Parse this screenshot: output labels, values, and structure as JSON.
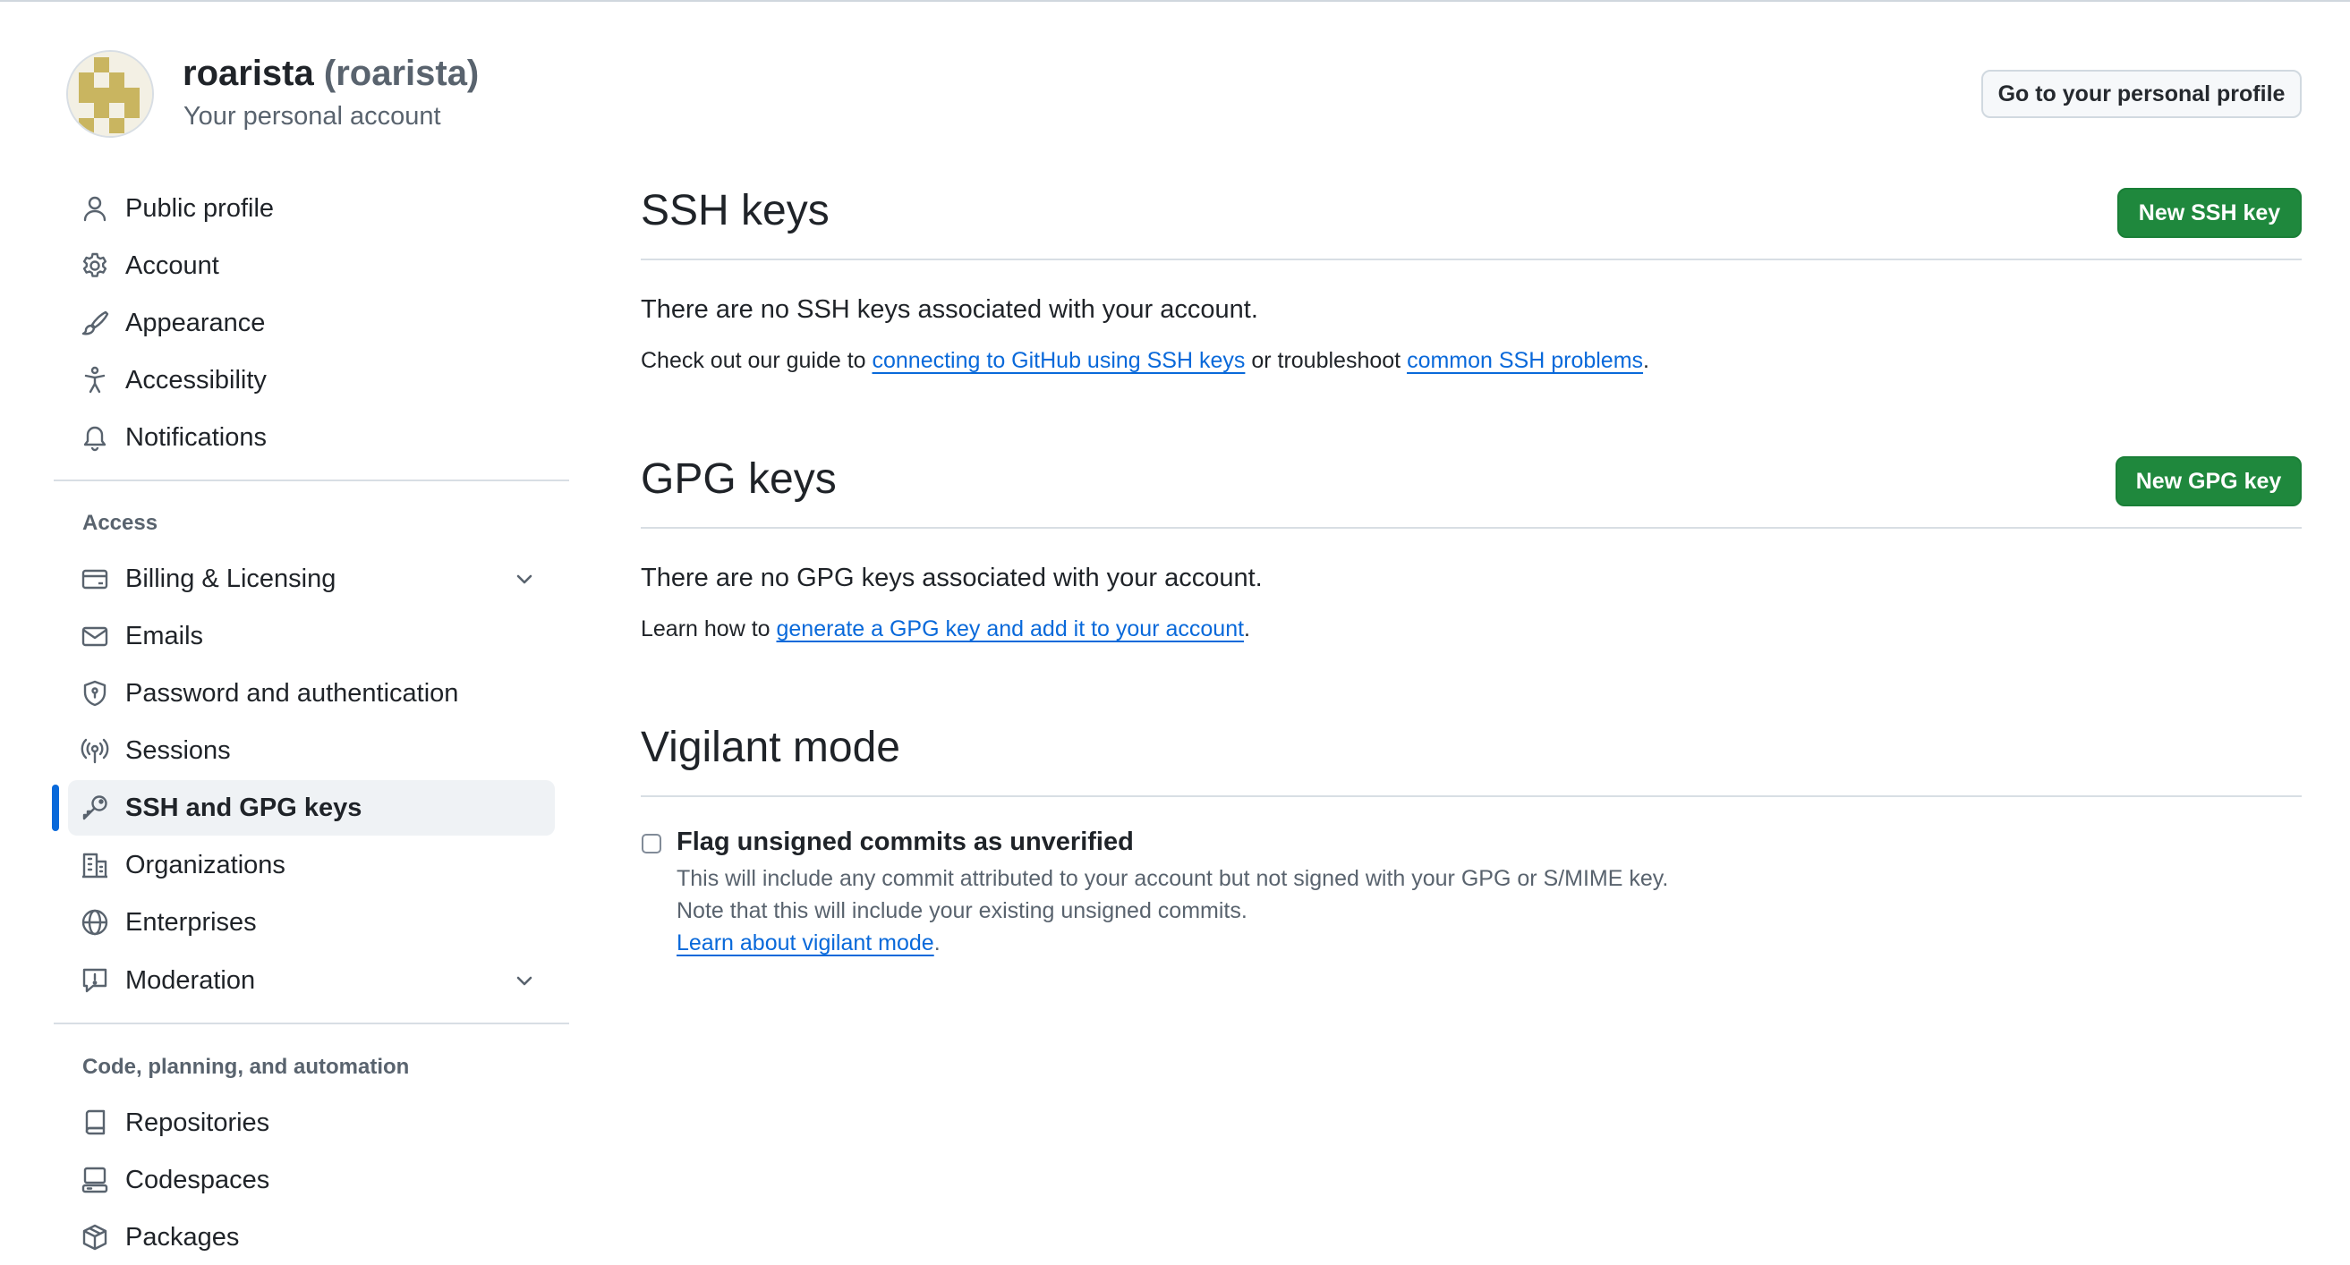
{
  "header": {
    "display_name": "roarista",
    "login": "(roarista)",
    "subtitle": "Your personal account",
    "profile_button": "Go to your personal profile"
  },
  "sidebar": {
    "top_items": [
      {
        "label": "Public profile",
        "icon": "person-icon"
      },
      {
        "label": "Account",
        "icon": "gear-icon"
      },
      {
        "label": "Appearance",
        "icon": "paintbrush-icon"
      },
      {
        "label": "Accessibility",
        "icon": "accessibility-icon"
      },
      {
        "label": "Notifications",
        "icon": "bell-icon"
      }
    ],
    "access_heading": "Access",
    "access_items": [
      {
        "label": "Billing & Licensing",
        "icon": "credit-card-icon",
        "expandable": true
      },
      {
        "label": "Emails",
        "icon": "mail-icon"
      },
      {
        "label": "Password and authentication",
        "icon": "shield-lock-icon"
      },
      {
        "label": "Sessions",
        "icon": "broadcast-icon"
      },
      {
        "label": "SSH and GPG keys",
        "icon": "key-icon",
        "active": true
      },
      {
        "label": "Organizations",
        "icon": "organization-icon"
      },
      {
        "label": "Enterprises",
        "icon": "globe-icon"
      },
      {
        "label": "Moderation",
        "icon": "report-icon",
        "expandable": true
      }
    ],
    "code_heading": "Code, planning, and automation",
    "code_items": [
      {
        "label": "Repositories",
        "icon": "repo-icon"
      },
      {
        "label": "Codespaces",
        "icon": "codespaces-icon"
      },
      {
        "label": "Packages",
        "icon": "package-icon"
      }
    ]
  },
  "ssh": {
    "title": "SSH keys",
    "new_button": "New SSH key",
    "empty_message": "There are no SSH keys associated with your account.",
    "guide_prefix": "Check out our guide to ",
    "guide_link": "connecting to GitHub using SSH keys",
    "guide_middle": " or troubleshoot ",
    "trouble_link": "common SSH problems",
    "guide_suffix": "."
  },
  "gpg": {
    "title": "GPG keys",
    "new_button": "New GPG key",
    "empty_message": "There are no GPG keys associated with your account.",
    "learn_prefix": "Learn how to ",
    "learn_link": "generate a GPG key and add it to your account",
    "learn_suffix": "."
  },
  "vigilant": {
    "title": "Vigilant mode",
    "checkbox_label": "Flag unsigned commits as unverified",
    "checked": false,
    "note_line1": "This will include any commit attributed to your account but not signed with your GPG or S/MIME key.",
    "note_line2": "Note that this will include your existing unsigned commits.",
    "learn_link": "Learn about vigilant mode",
    "learn_suffix": "."
  },
  "colors": {
    "primary_button": "#1f883d",
    "link": "#0969da",
    "active_indicator": "#0969da",
    "avatar_gold": "#c9b560"
  }
}
